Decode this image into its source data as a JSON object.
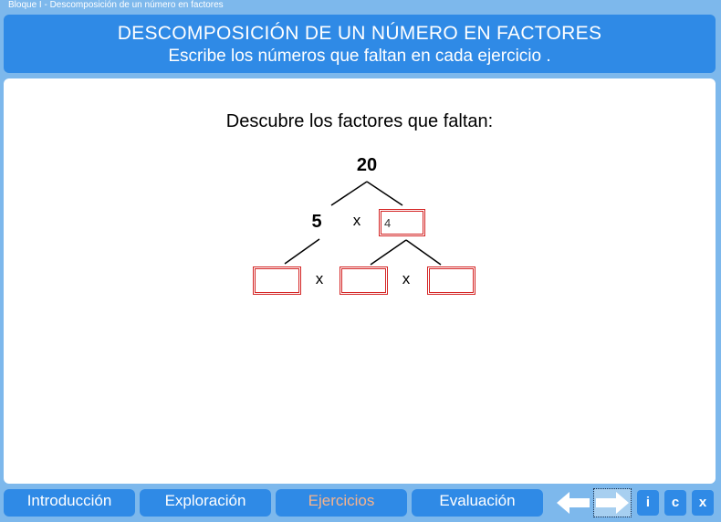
{
  "app": {
    "window_title": "Bloque I - Descomposición de un número en factores"
  },
  "header": {
    "title": "DESCOMPOSICIÓN DE UN NÚMERO EN FACTORES",
    "subtitle": "Escribe los números que faltan en cada ejercicio ."
  },
  "exercise": {
    "instruction": "Descubre los factores que faltan:",
    "root_number": "20",
    "left_factor": "5",
    "times_symbol": "x",
    "right_factor_value": "4",
    "bottom_left_value": "",
    "bottom_middle_value": "",
    "bottom_right_value": ""
  },
  "nav": {
    "tabs": [
      "Introducción",
      "Exploración",
      "Ejercicios",
      "Evaluación"
    ],
    "active_tab": "Ejercicios",
    "back_icon": "arrow-left-icon",
    "forward_icon": "arrow-right-icon",
    "info_label": "i",
    "c_label": "c",
    "close_label": "x"
  },
  "colors": {
    "background": "#7db8ec",
    "panel": "#2f8ae6",
    "active_tab_text": "#f6b38c",
    "input_border": "#d42424"
  }
}
